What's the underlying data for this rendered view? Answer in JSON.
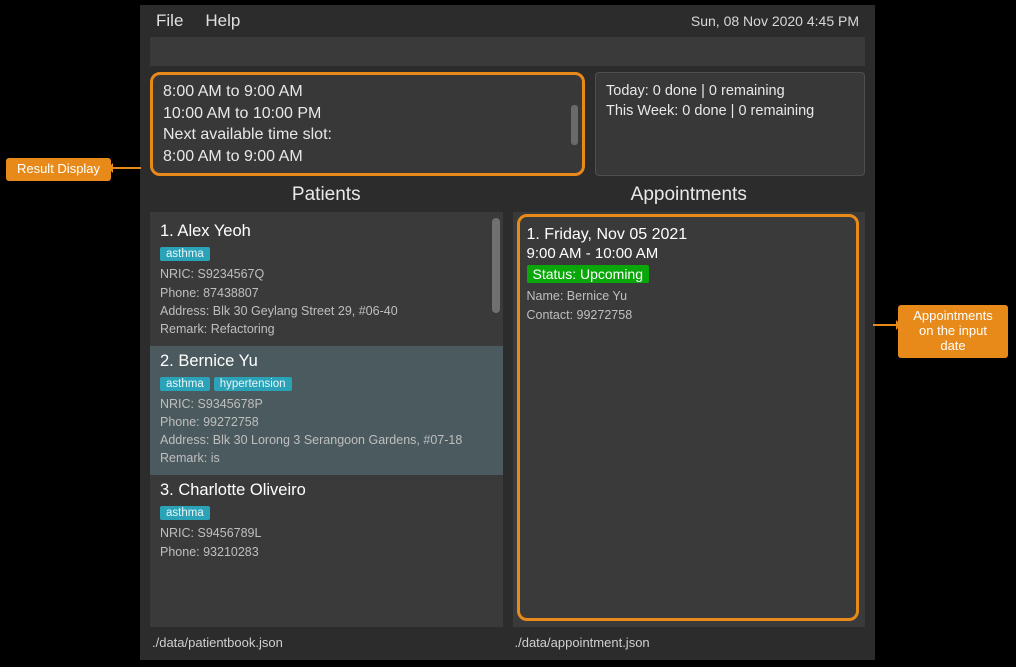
{
  "menu": {
    "file": "File",
    "help": "Help"
  },
  "clock": "Sun, 08 Nov 2020 4:45 PM",
  "command_input": {
    "value": "",
    "placeholder": ""
  },
  "result_display": {
    "lines": [
      "8:00 AM to 9:00 AM",
      "10:00 AM to 10:00 PM",
      "Next available time slot:",
      "8:00 AM to 9:00 AM"
    ]
  },
  "stats": {
    "today": "Today: 0 done | 0 remaining",
    "week": "This Week: 0 done | 0 remaining"
  },
  "headers": {
    "patients": "Patients",
    "appointments": "Appointments"
  },
  "patients": [
    {
      "index": "1.",
      "name": "Alex Yeoh",
      "tags": [
        "asthma"
      ],
      "nric": "NRIC: S9234567Q",
      "phone": "Phone: 87438807",
      "address": "Address: Blk 30 Geylang Street 29, #06-40",
      "remark": "Remark: Refactoring",
      "selected": false
    },
    {
      "index": "2.",
      "name": "Bernice Yu",
      "tags": [
        "asthma",
        "hypertension"
      ],
      "nric": "NRIC: S9345678P",
      "phone": "Phone: 99272758",
      "address": "Address: Blk 30 Lorong 3 Serangoon Gardens, #07-18",
      "remark": "Remark: is",
      "selected": true
    },
    {
      "index": "3.",
      "name": "Charlotte Oliveiro",
      "tags": [
        "asthma"
      ],
      "nric": "NRIC: S9456789L",
      "phone": "Phone: 93210283",
      "address": "",
      "remark": "",
      "selected": false
    }
  ],
  "appointments": [
    {
      "index": "1.",
      "date": "Friday, Nov 05 2021",
      "time": "9:00 AM - 10:00 AM",
      "status": "Status: Upcoming",
      "name": "Name: Bernice Yu",
      "contact": "Contact: 99272758"
    }
  ],
  "footer": {
    "patients_path": "./data/patientbook.json",
    "appointments_path": "./data/appointment.json"
  },
  "callouts": {
    "left": "Result Display",
    "right": "Appointments on the input date"
  }
}
